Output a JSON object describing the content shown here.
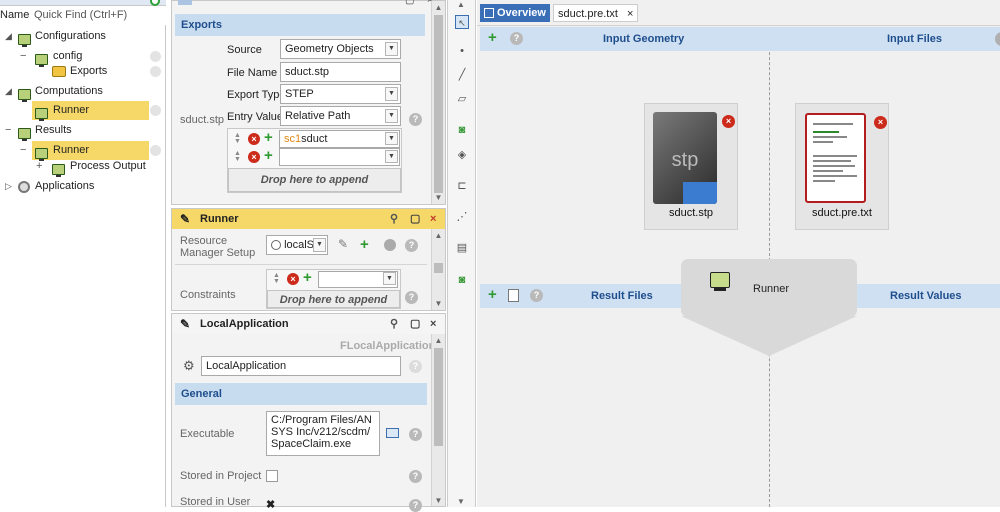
{
  "tree": {
    "header_name": "Name",
    "quick_find": "Quick Find (Ctrl+F)",
    "items": [
      {
        "label": "Configurations"
      },
      {
        "label": "config"
      },
      {
        "label": "Exports"
      },
      {
        "label": "Computations"
      },
      {
        "label": "Runner"
      },
      {
        "label": "Results"
      },
      {
        "label": "Runner"
      },
      {
        "label": "Process Output"
      },
      {
        "label": "Applications"
      }
    ]
  },
  "exports_panel": {
    "section": "Exports",
    "row_label": "sduct.stp",
    "source_label": "Source",
    "source_value": "Geometry Objects",
    "filename_label": "File Name",
    "filename_value": "sduct.stp",
    "export_type_label": "Export Type",
    "export_type_value": "STEP",
    "entry_value_label": "Entry Value",
    "entry_value_value": "Relative Path",
    "list_prefix": "sc1",
    "list_value": "sduct",
    "drop_text": "Drop here to append"
  },
  "runner_panel": {
    "title": "Runner",
    "resource_label": "Resource Manager Setup",
    "resource_value": "localS",
    "constraints_label": "Constraints",
    "drop_text": "Drop here to append"
  },
  "localapp_panel": {
    "title": "LocalApplication",
    "type_label": "FLocalApplication",
    "name_value": "LocalApplication",
    "section": "General",
    "executable_label": "Executable",
    "executable_value": "C:/Program Files/ANSYS Inc/v212/scdm/SpaceClaim.exe",
    "stored_project_label": "Stored in Project",
    "stored_user_label": "Stored in User"
  },
  "canvas": {
    "tabs": [
      {
        "label": "Overview"
      },
      {
        "label": "sduct.pre.txt"
      }
    ],
    "input_geometry": "Input Geometry",
    "input_files": "Input Files",
    "result_files": "Result Files",
    "result_values": "Result Values",
    "tile_stp_icon_text": "stp",
    "tile_stp_caption": "sduct.stp",
    "tile_txt_caption": "sduct.pre.txt",
    "runner_label": "Runner"
  }
}
